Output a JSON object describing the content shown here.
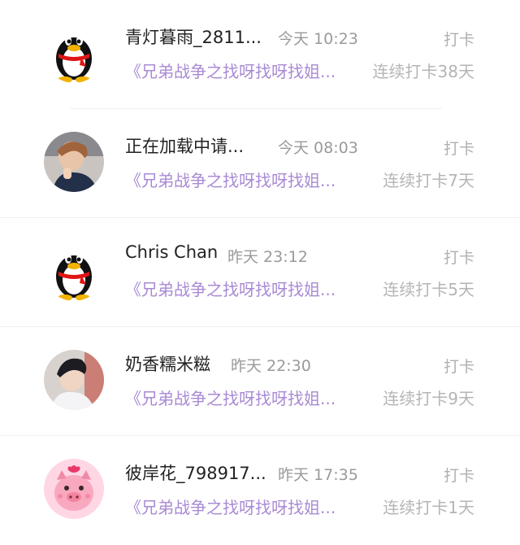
{
  "list": {
    "items": [
      {
        "name": "青灯暮雨_2811...",
        "time": "今天 10:23",
        "action": "打卡",
        "topic": "《兄弟战争之找呀找呀找姐...",
        "streak": "连续打卡38天",
        "avatar": "penguin-icon"
      },
      {
        "name": "正在加载中请...",
        "time": "今天 08:03",
        "action": "打卡",
        "topic": "《兄弟战争之找呀找呀找姐...",
        "streak": "连续打卡7天",
        "avatar": "photo-avatar"
      },
      {
        "name": "Chris Chan",
        "time": "昨天 23:12",
        "action": "打卡",
        "topic": "《兄弟战争之找呀找呀找姐...",
        "streak": "连续打卡5天",
        "avatar": "penguin-icon"
      },
      {
        "name": "奶香糯米糍",
        "time": "昨天 22:30",
        "action": "打卡",
        "topic": "《兄弟战争之找呀找呀找姐...",
        "streak": "连续打卡9天",
        "avatar": "photo-avatar"
      },
      {
        "name": "彼岸花_798917...",
        "time": "昨天 17:35",
        "action": "打卡",
        "topic": "《兄弟战争之找呀找呀找姐...",
        "streak": "连续打卡1天",
        "avatar": "pig-icon"
      }
    ]
  }
}
